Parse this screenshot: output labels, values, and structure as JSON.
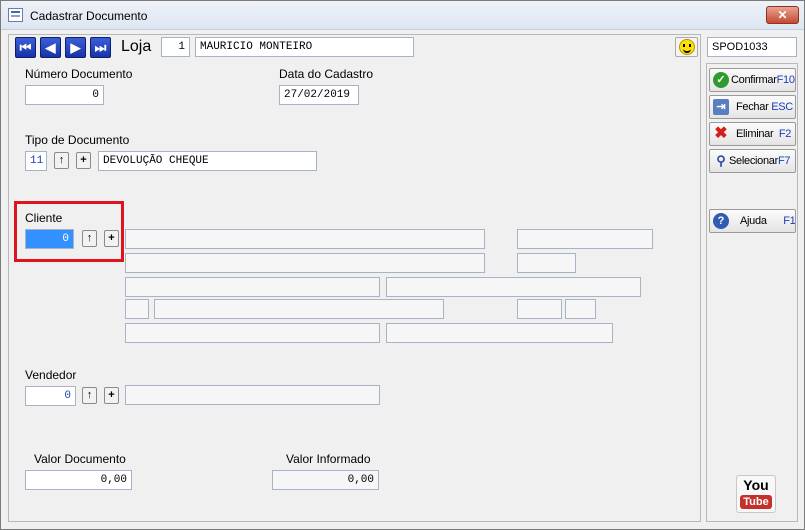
{
  "window": {
    "title": "Cadastrar Documento",
    "close_icon": "close-icon"
  },
  "header": {
    "nav": [
      {
        "name": "first-record-button",
        "glyph": "|◀"
      },
      {
        "name": "previous-record-button",
        "glyph": "◀"
      },
      {
        "name": "next-record-button",
        "glyph": "▶"
      },
      {
        "name": "last-record-button",
        "glyph": "▶|"
      }
    ],
    "loja_label": "Loja",
    "loja_code": "1",
    "loja_name": "MAURICIO MONTEIRO",
    "session_code": "SPOD1033"
  },
  "form": {
    "numero_documento": {
      "label": "Número Documento",
      "value": "0"
    },
    "data_cadastro": {
      "label": "Data do Cadastro",
      "value": "27/02/2019"
    },
    "tipo_documento": {
      "label": "Tipo de Documento",
      "code": "11",
      "description": "DEVOLUÇÃO CHEQUE"
    },
    "cliente": {
      "label": "Cliente",
      "code": "0"
    },
    "vendedor": {
      "label": "Vendedor",
      "code": "0",
      "name": ""
    },
    "valor_documento": {
      "label": "Valor Documento",
      "value": "0,00"
    },
    "valor_informado": {
      "label": "Valor Informado",
      "value": "0,00"
    }
  },
  "side_buttons": {
    "confirmar": {
      "label": "Confirmar",
      "key": "F10",
      "icon": "check-icon"
    },
    "fechar": {
      "label": "Fechar",
      "key": "ESC",
      "icon": "close-door-icon"
    },
    "eliminar": {
      "label": "Eliminar",
      "key": "F2",
      "icon": "delete-x-icon"
    },
    "selecionar": {
      "label": "Selecionar",
      "key": "F7",
      "icon": "magnifier-icon"
    },
    "ajuda": {
      "label": "Ajuda",
      "key": "F1",
      "icon": "help-icon"
    }
  },
  "youtube": {
    "you": "You",
    "tube": "Tube"
  },
  "colors": {
    "nav_blue": "#1833a8",
    "highlight_red": "#e0141e",
    "key_blue": "#1a3fb8",
    "selection_blue": "#3390ff"
  }
}
